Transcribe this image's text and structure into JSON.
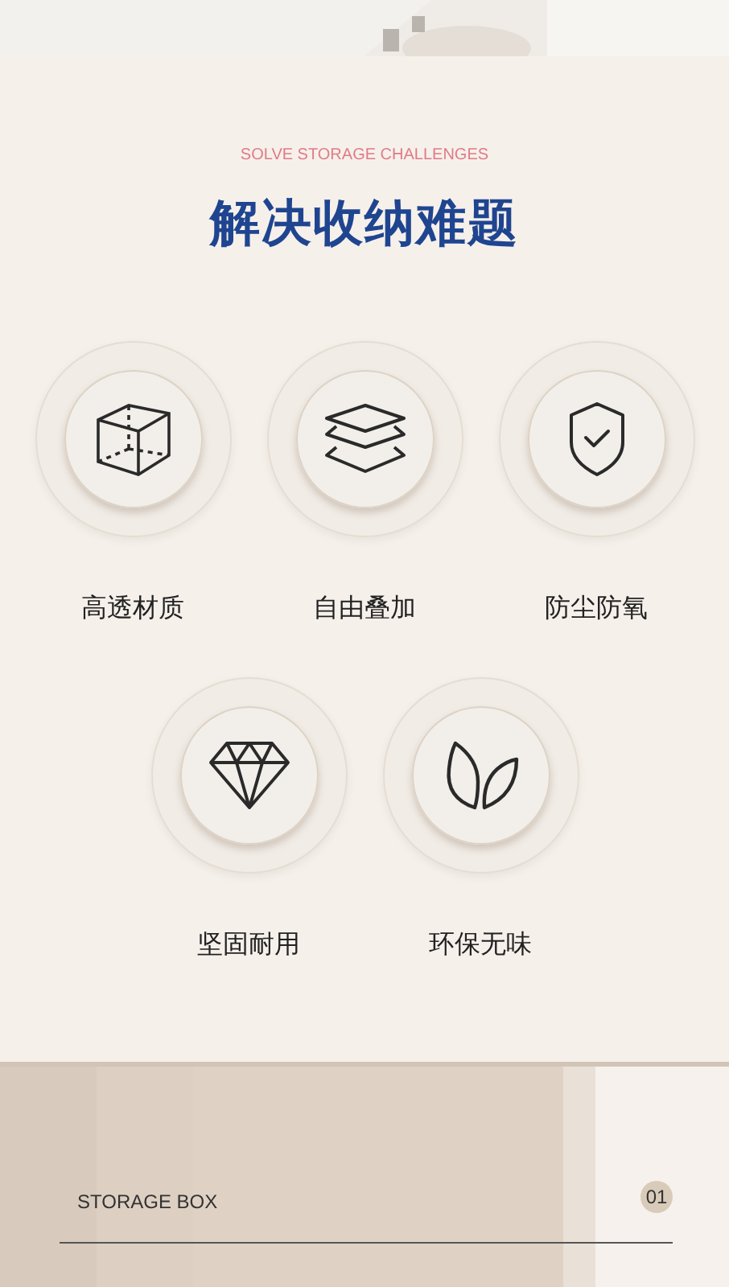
{
  "subtitle": "SOLVE STORAGE CHALLENGES",
  "title": "解决收纳难题",
  "features": [
    {
      "kind": "cube",
      "label": "高透材质"
    },
    {
      "kind": "layers",
      "label": "自由叠加"
    },
    {
      "kind": "shield",
      "label": "防尘防氧"
    },
    {
      "kind": "diamond",
      "label": "坚固耐用"
    },
    {
      "kind": "leaves",
      "label": "环保无味"
    }
  ],
  "footer": {
    "label": "STORAGE BOX",
    "number": "01"
  }
}
